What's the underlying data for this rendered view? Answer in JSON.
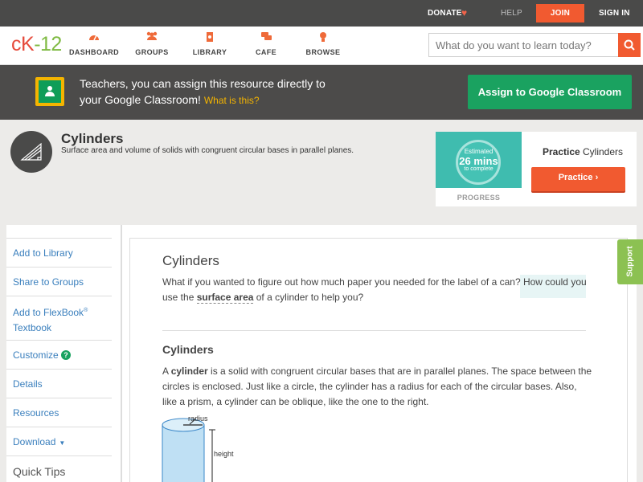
{
  "topbar": {
    "donate": "DONATE",
    "help": "HELP",
    "join": "JOIN",
    "signin": "SIGN IN"
  },
  "logo": {
    "ck": "cK",
    "dash": "-",
    "num": "12"
  },
  "nav": [
    {
      "label": "DASHBOARD",
      "icon": "dashboard-icon"
    },
    {
      "label": "GROUPS",
      "icon": "groups-icon"
    },
    {
      "label": "LIBRARY",
      "icon": "library-icon"
    },
    {
      "label": "CAFE",
      "icon": "cafe-icon"
    },
    {
      "label": "BROWSE",
      "icon": "lightbulb-icon"
    }
  ],
  "search": {
    "placeholder": "What do you want to learn today?"
  },
  "banner": {
    "line1": "Teachers, you can assign this resource directly to",
    "line2": "your Google Classroom!",
    "what": "What is this?",
    "button": "Assign to Google Classroom"
  },
  "concept": {
    "title": "Cylinders",
    "subtitle": "Surface area and volume of solids with congruent circular bases in parallel planes."
  },
  "practice": {
    "estimated": "Estimated",
    "mins": "26 mins",
    "complete": "to complete",
    "progress_label": "PROGRESS",
    "title_bold": "Practice",
    "title_rest": " Cylinders",
    "button": "Practice"
  },
  "sidebar": {
    "items": [
      "Add to Library",
      "Share to Groups",
      "Add to FlexBook",
      "Textbook",
      "Customize",
      "Details",
      "Resources",
      "Download",
      "Quick Tips"
    ],
    "flexbook_sup": "®"
  },
  "support": "Support",
  "article": {
    "title": "Cylinders",
    "intro_pre": "What if you wanted to figure out how much paper you needed for the label of a can? How could you use the ",
    "intro_term": "surface area",
    "intro_post": " of a cylinder to help you?",
    "section_title": "Cylinders",
    "body_a": "A ",
    "body_term": "cylinder",
    "body_b": " is a solid with congruent circular bases that are in parallel planes. The space between the circles is enclosed. Just like a circle, the cylinder has a radius for each of the circular bases. Also, like a prism, a cylinder can be oblique, like the one to the right.",
    "fig_radius": "radius",
    "fig_height": "height"
  },
  "colors": {
    "accent": "#f15a30",
    "google_green": "#1aa260",
    "link": "#3a7fbd",
    "support": "#8cc152"
  }
}
